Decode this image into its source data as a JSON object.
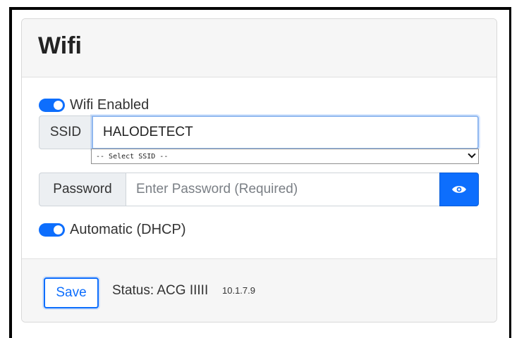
{
  "panel": {
    "title": "Wifi"
  },
  "wifi": {
    "enabled_label": "Wifi Enabled",
    "enabled": true
  },
  "ssid": {
    "label": "SSID",
    "value": "HALODETECT",
    "select_placeholder": "-- Select SSID --"
  },
  "password": {
    "label": "Password",
    "placeholder": "Enter Password (Required)",
    "show_icon": "eye-icon"
  },
  "dhcp": {
    "label": "Automatic (DHCP)",
    "enabled": true
  },
  "footer": {
    "save_label": "Save",
    "status_label": "Status: ACG IIIII",
    "status_ip": "10.1.7.9"
  },
  "colors": {
    "accent": "#0d6efd",
    "header_bg": "#f6f6f6",
    "addon_bg": "#eceff2"
  }
}
